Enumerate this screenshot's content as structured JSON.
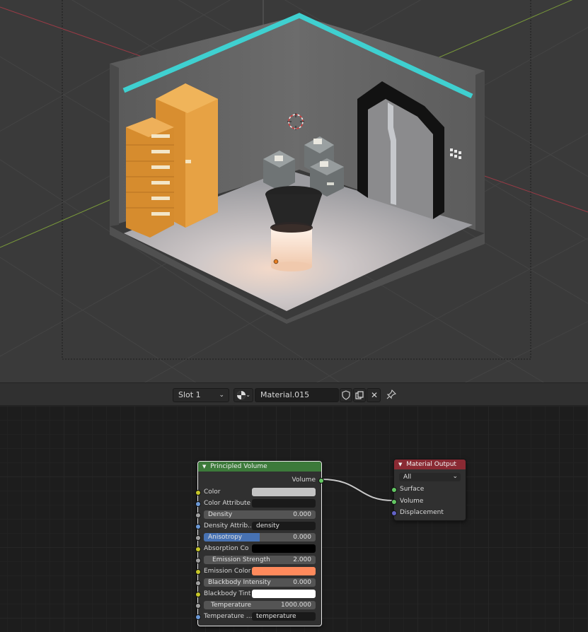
{
  "header": {
    "slot_label": "Slot 1",
    "material_name": "Material.015"
  },
  "principled_volume": {
    "title": "Principled Volume",
    "output_volume": "Volume",
    "inputs": {
      "color": "Color",
      "color_value": "#c4c4c4",
      "color_attribute": "Color Attribute",
      "density_label": "Density",
      "density_value": "0.000",
      "density_attribute": "Density Attrib...",
      "density_attribute_value": "density",
      "anisotropy_label": "Anisotropy",
      "anisotropy_value": "0.000",
      "absorption_color": "Absorption Co",
      "absorption_value": "#000000",
      "emission_strength_label": "Emission Strength",
      "emission_strength_value": "2.000",
      "emission_color": "Emission Color",
      "emission_value": "#ff8a5c",
      "blackbody_intensity_label": "Blackbody Intensity",
      "blackbody_intensity_value": "0.000",
      "blackbody_tint": "Blackbody Tint",
      "blackbody_tint_value": "#ffffff",
      "temperature_label": "Temperature",
      "temperature_value": "1000.000",
      "temperature_attribute": "Temperature ...",
      "temperature_attribute_value": "temperature"
    }
  },
  "material_output": {
    "title": "Material Output",
    "target": "All",
    "surface": "Surface",
    "volume": "Volume",
    "displacement": "Displacement"
  },
  "colors": {
    "accent": "#4772b3",
    "neon": "#3fd0d0",
    "cabinet": "#e09a3c"
  }
}
